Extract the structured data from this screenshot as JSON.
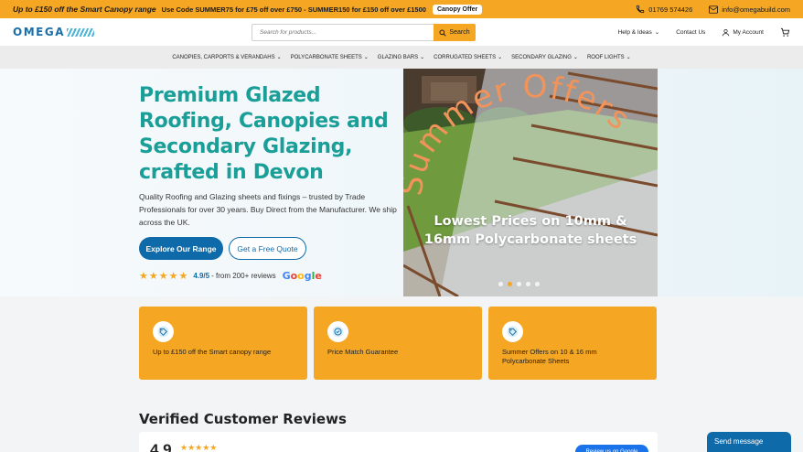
{
  "promo": {
    "lead": "Up to £150 off the Smart Canopy range",
    "codes": "Use Code SUMMER75 for £75 off over £750 - SUMMER150 for £150 off over £1500",
    "offer_button": "Canopy Offer",
    "phone": "01769 574426",
    "email": "info@omegabuild.com"
  },
  "header": {
    "logo": "OMEGA",
    "search_placeholder": "Search for products...",
    "search_button": "Search",
    "help": "Help & Ideas",
    "contact": "Contact Us",
    "account": "My Account"
  },
  "nav": {
    "items": [
      "CANOPIES, CARPORTS & VERANDAHS",
      "POLYCARBONATE SHEETS",
      "GLAZING BARS",
      "CORRUGATED SHEETS",
      "SECONDARY GLAZING",
      "ROOF LIGHTS"
    ]
  },
  "hero": {
    "title": "Premium Glazed Roofing, Canopies and Secondary Glazing, crafted in Devon",
    "subtitle": "Quality Roofing and Glazing sheets and fixings – trusted by Trade Professionals for over 30 years. Buy Direct from the Manufacturer. We ship across the UK.",
    "primary_button": "Explore Our Range",
    "secondary_button": "Get a Free Quote",
    "rating_value": "4.9/5",
    "rating_text": "- from 200+ reviews",
    "google_logo": "Google"
  },
  "slide": {
    "headline": "Summer Offers",
    "text_line1": "Lowest Prices on 10mm &",
    "text_line2": "16mm Polycarbonate sheets",
    "dot_count": 5,
    "active_dot": 2
  },
  "cards": [
    {
      "label": "Up to £150 off the Smart canopy range",
      "icon": "tag-icon"
    },
    {
      "label": "Price Match Guarantee",
      "icon": "check-badge-icon"
    },
    {
      "label": "Summer Offers on 10 & 16 mm Polycarbonate Sheets",
      "icon": "tag-icon"
    }
  ],
  "reviews": {
    "title": "Verified Customer Reviews",
    "score": "4.9",
    "google_button": "Review us on Google"
  },
  "chat": {
    "label": "Send message"
  },
  "colors": {
    "accent": "#f5a623",
    "brand": "#0e6aa8",
    "teal": "#1a9e98"
  }
}
